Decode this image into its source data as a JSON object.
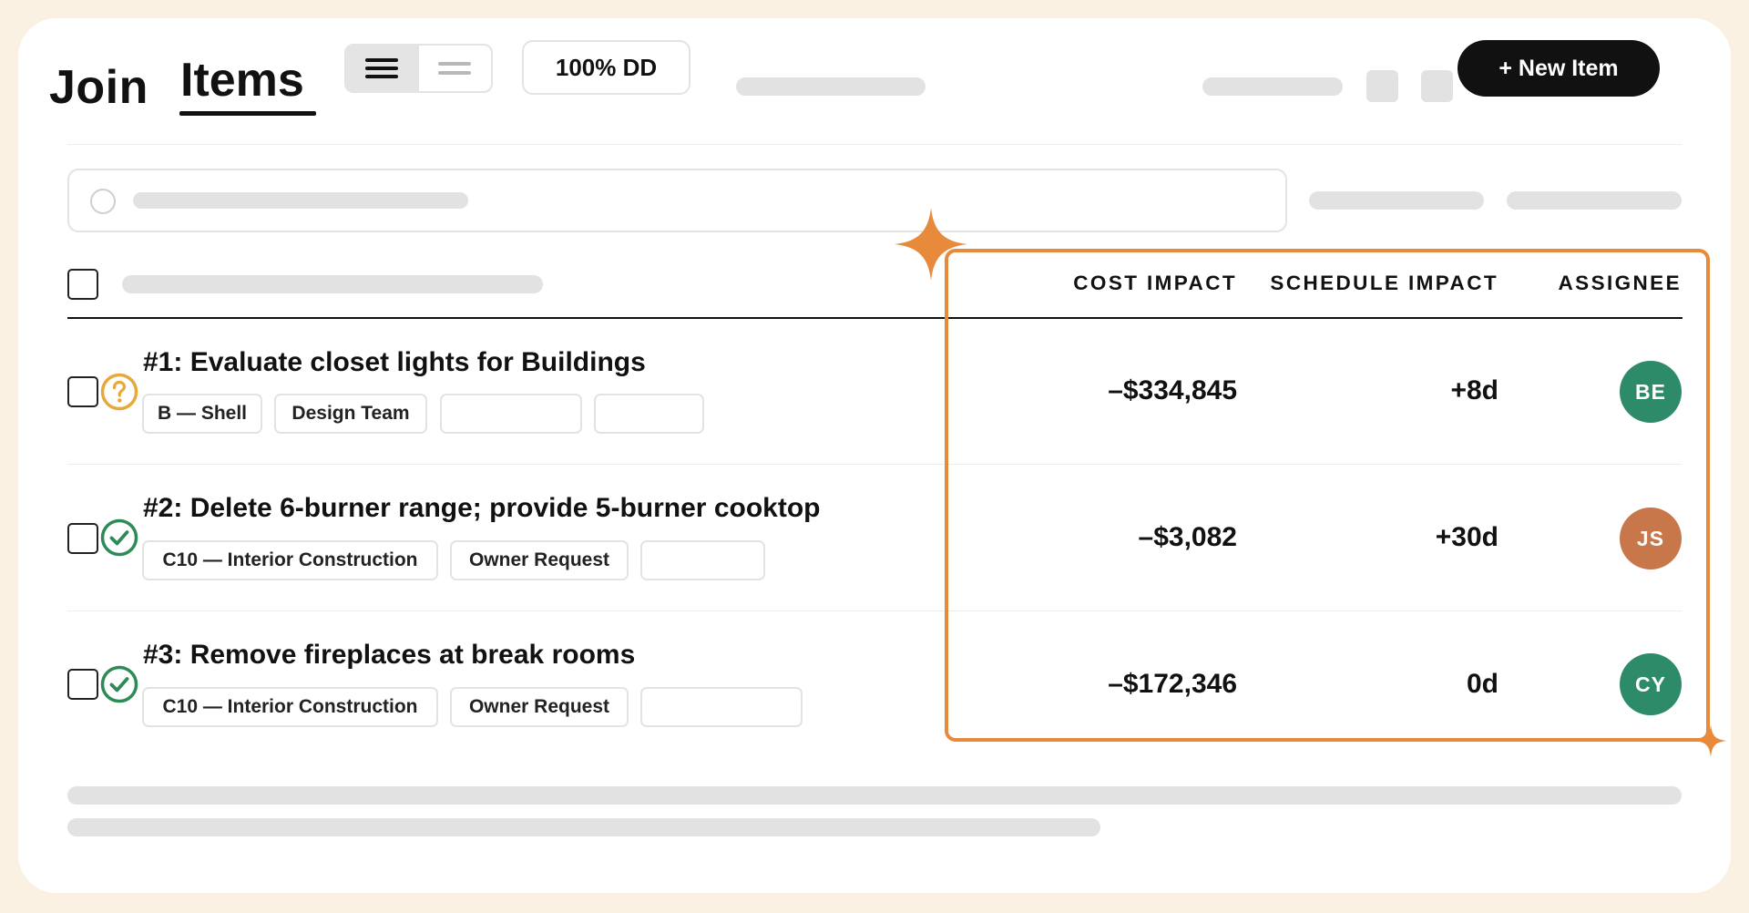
{
  "app": {
    "logo": "Join"
  },
  "header": {
    "tab_items": "Items",
    "phase_button": "100% DD",
    "new_item_button": "+ New Item"
  },
  "table": {
    "columns": {
      "cost_impact": "COST IMPACT",
      "schedule_impact": "SCHEDULE IMPACT",
      "assignee": "ASSIGNEE"
    },
    "rows": [
      {
        "title": "#1: Evaluate closet lights for Buildings",
        "status": "question-icon",
        "tags": [
          "B — Shell",
          "Design Team",
          "",
          ""
        ],
        "cost": "–$334,845",
        "schedule": "+8d",
        "assignee": "BE",
        "assignee_color": "#2e8b6a"
      },
      {
        "title": "#2: Delete 6-burner range; provide 5-burner cooktop",
        "status": "check-circle-icon",
        "tags": [
          "C10 — Interior Construction",
          "Owner Request",
          ""
        ],
        "cost": "–$3,082",
        "schedule": "+30d",
        "assignee": "JS",
        "assignee_color": "#c8774a"
      },
      {
        "title": "#3: Remove fireplaces at break rooms",
        "status": "check-circle-icon",
        "tags": [
          "C10 — Interior Construction",
          "Owner Request",
          ""
        ],
        "cost": "–$172,346",
        "schedule": "0d",
        "assignee": "CY",
        "assignee_color": "#2e8b6a"
      }
    ]
  },
  "colors": {
    "highlight": "#e88a3c",
    "status_pending": "#e8a93c",
    "status_done": "#2e8b57",
    "background": "#fbf1e2"
  }
}
